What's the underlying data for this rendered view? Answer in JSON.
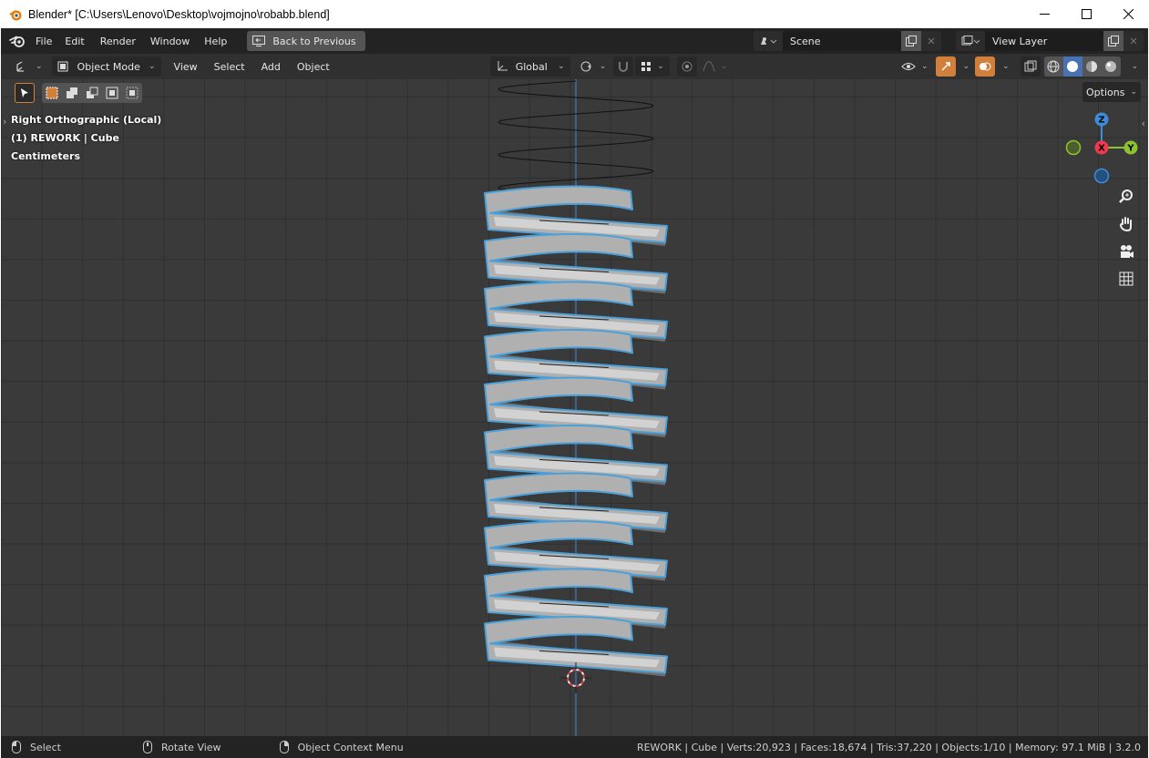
{
  "window": {
    "title": "Blender* [C:\\Users\\Lenovo\\Desktop\\vojmojno\\robabb.blend]",
    "minimize_label": "minimize",
    "maximize_label": "maximize",
    "close_label": "close"
  },
  "topbar": {
    "menus": [
      "File",
      "Edit",
      "Render",
      "Window",
      "Help"
    ],
    "back_button": "Back to Previous",
    "scene": "Scene",
    "view_layer": "View Layer"
  },
  "viewport_header": {
    "mode": "Object Mode",
    "menus": [
      "View",
      "Select",
      "Add",
      "Object"
    ],
    "orientation": "Global"
  },
  "viewport": {
    "view_name": "Right Orthographic (Local)",
    "object_info": "(1) REWORK | Cube",
    "units": "Centimeters",
    "options_label": "Options",
    "gizmo": {
      "z": "Z",
      "x": "X",
      "y": "Y"
    },
    "colors": {
      "selection": "#4ba0d9",
      "x_axis": "#f2394f",
      "y_axis": "#8bc42e",
      "z_axis": "#3d8bd9"
    }
  },
  "statusbar": {
    "left_mouse": "Select",
    "middle_mouse": "Rotate View",
    "right_mouse": "Object Context Menu",
    "stats": "REWORK | Cube | Verts:20,923 | Faces:18,674 | Tris:37,220 | Objects:1/10 | Memory: 97.1 MiB | 3.2.0"
  }
}
